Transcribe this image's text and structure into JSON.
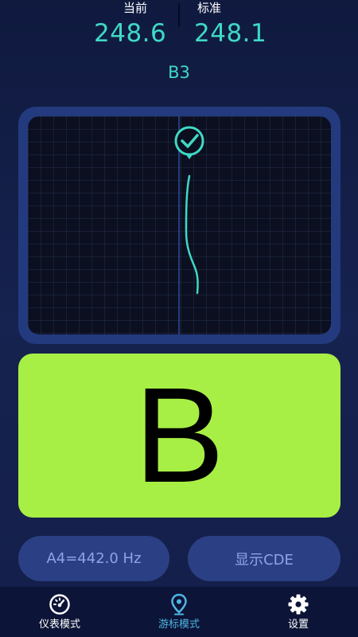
{
  "header": {
    "current_label": "当前",
    "current_value": "248.6",
    "standard_label": "标准",
    "standard_value": "248.1"
  },
  "note": {
    "name": "B3",
    "letter": "B"
  },
  "graph": {
    "status_icon": "check-circle-icon",
    "accent_color": "#3fd9c4"
  },
  "buttons": {
    "a4_label": "A4=442.0 Hz",
    "cde_label": "显示CDE"
  },
  "nav": {
    "items": [
      {
        "label": "仪表模式",
        "icon": "gauge-icon",
        "active": false
      },
      {
        "label": "游标模式",
        "icon": "location-pin-icon",
        "active": true
      },
      {
        "label": "设置",
        "icon": "gear-icon",
        "active": false
      }
    ]
  },
  "colors": {
    "background": "#14204a",
    "accent": "#3fd9c4",
    "note_card": "#a8ef45",
    "pill_bg": "#2b3f84",
    "nav_active": "#4fb6e4"
  }
}
